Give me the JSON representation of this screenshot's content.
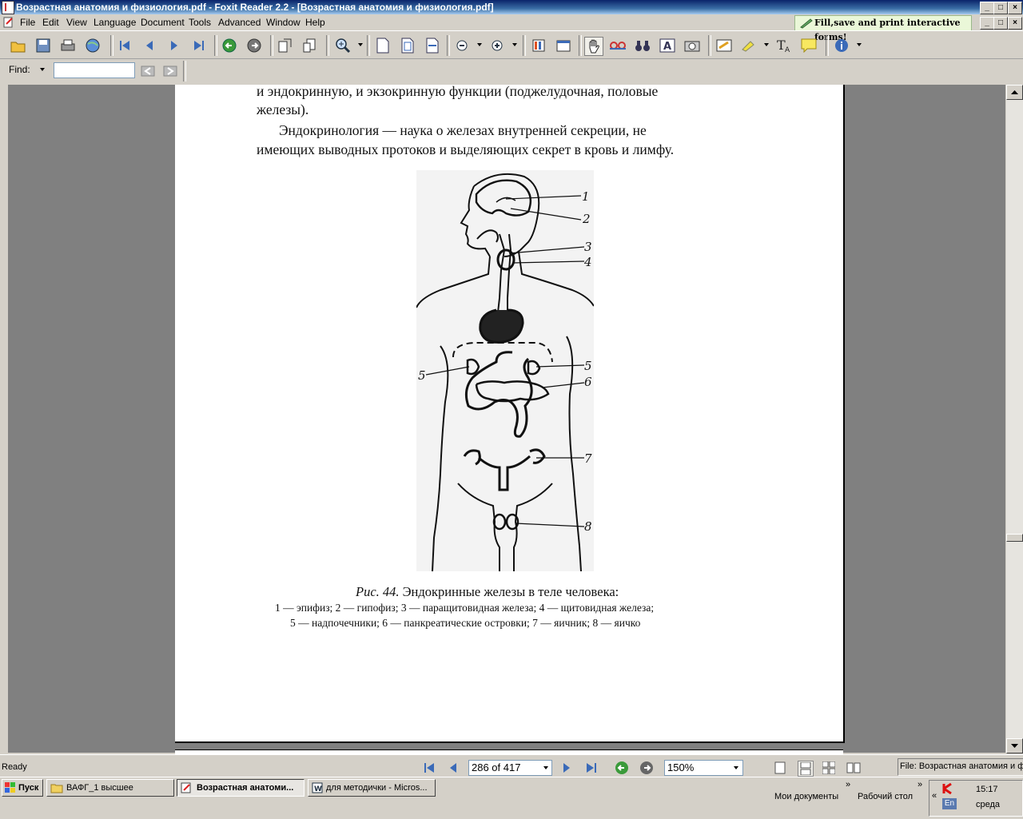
{
  "window": {
    "title": "Возрастная анатомия и физиология.pdf - Foxit Reader 2.2 - [Возрастная анатомия и физиология.pdf]",
    "min": "_",
    "max": "□",
    "close": "×"
  },
  "menu": {
    "items": [
      "File",
      "Edit",
      "View",
      "Language",
      "Document",
      "Tools",
      "Advanced",
      "Window",
      "Help"
    ],
    "promo": "Fill,save and print interactive forms!"
  },
  "findbar": {
    "label": "Find:",
    "value": ""
  },
  "page": {
    "paragraph1_line1": "и  эндокринную,  и  экзокринную  функции  (поджелудочная,  половые",
    "paragraph1_line2": "железы).",
    "paragraph2_line1": "Эндокринология  —  наука  о  железах  внутренней  секреции,  не",
    "paragraph2_line2": "имеющих выводных протоков и выделяющих секрет в кровь и лимфу.",
    "figure_labels": [
      "1",
      "2",
      "3",
      "4",
      "5",
      "5",
      "6",
      "7",
      "8"
    ],
    "caption_prefix": "Рис. 44.",
    "caption_title": " Эндокринные железы в теле человека:",
    "legend_line1": "1 — эпифиз; 2 — гипофиз; 3 — паращитовидная железа; 4 — щитовидная железа;",
    "legend_line2": "5 — надпочечники; 6 — панкреатические островки; 7 — яичник; 8 — яичко"
  },
  "status": {
    "ready": "Ready",
    "page_indicator": "286 of 417",
    "zoom": "150%",
    "file": "File: Возрастная анатомия и фи"
  },
  "taskbar": {
    "start": "Пуск",
    "tasks": [
      {
        "label": "ВАФГ_1 высшее",
        "active": false
      },
      {
        "label": "Возрастная анатоми...",
        "active": true
      },
      {
        "label": "для методички - Micros...",
        "active": false
      }
    ],
    "quick1": "Мои документы",
    "quick2": "Рабочий стол",
    "lang": "En",
    "time": "15:17",
    "day": "среда"
  }
}
